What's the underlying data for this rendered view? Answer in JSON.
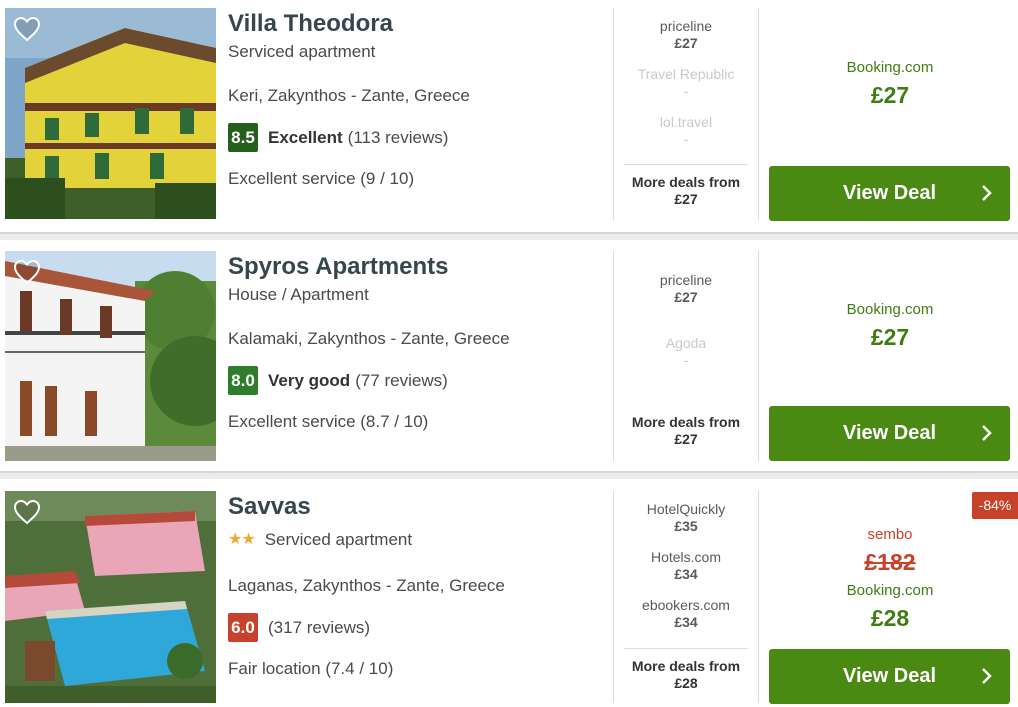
{
  "hotels": [
    {
      "name": "Villa Theodora",
      "type": "Serviced apartment",
      "stars": "",
      "location": "Keri, Zakynthos - Zante, Greece",
      "score": "8.5",
      "rating_word": "Excellent",
      "reviews": "(113 reviews)",
      "subscore": "Excellent service (9 / 10)",
      "deals": [
        {
          "site": "priceline",
          "price": "£27"
        },
        {
          "site": "Travel Republic",
          "price": "-"
        },
        {
          "site": "lol.travel",
          "price": "-"
        }
      ],
      "more_label": "More deals from",
      "more_price": "£27",
      "best_site": "Booking.com",
      "best_price": "£27",
      "button": "View Deal"
    },
    {
      "name": "Spyros Apartments",
      "type": "House / Apartment",
      "stars": "",
      "location": "Kalamaki, Zakynthos - Zante, Greece",
      "score": "8.0",
      "rating_word": "Very good",
      "reviews": "(77 reviews)",
      "subscore": "Excellent service (8.7 / 10)",
      "deals": [
        {
          "site": "priceline",
          "price": "£27"
        },
        {
          "site": "Agoda",
          "price": "-"
        }
      ],
      "more_label": "More deals from",
      "more_price": "£27",
      "best_site": "Booking.com",
      "best_price": "£27",
      "button": "View Deal"
    },
    {
      "name": "Savvas",
      "type": "Serviced apartment",
      "stars": "★★",
      "location": "Laganas, Zakynthos - Zante, Greece",
      "score": "6.0",
      "rating_word": "",
      "reviews": "(317 reviews)",
      "subscore": "Fair location (7.4 / 10)",
      "deals": [
        {
          "site": "HotelQuickly",
          "price": "£35"
        },
        {
          "site": "Hotels.com",
          "price": "£34"
        },
        {
          "site": "ebookers.com",
          "price": "£34"
        }
      ],
      "more_label": "More deals from",
      "more_price": "£28",
      "discount": "-84%",
      "old_site": "sembo",
      "old_price": "£182",
      "best_site": "Booking.com",
      "best_price": "£28",
      "button": "View Deal"
    }
  ],
  "colors": {
    "accent_green": "#4a8a12",
    "price_green": "#3f7d10",
    "score_green": "#2d7d2d",
    "score_red": "#c8412a",
    "star": "#f0a92e"
  },
  "icons": [
    "heart-icon",
    "chevron-right-icon",
    "star-icon"
  ]
}
